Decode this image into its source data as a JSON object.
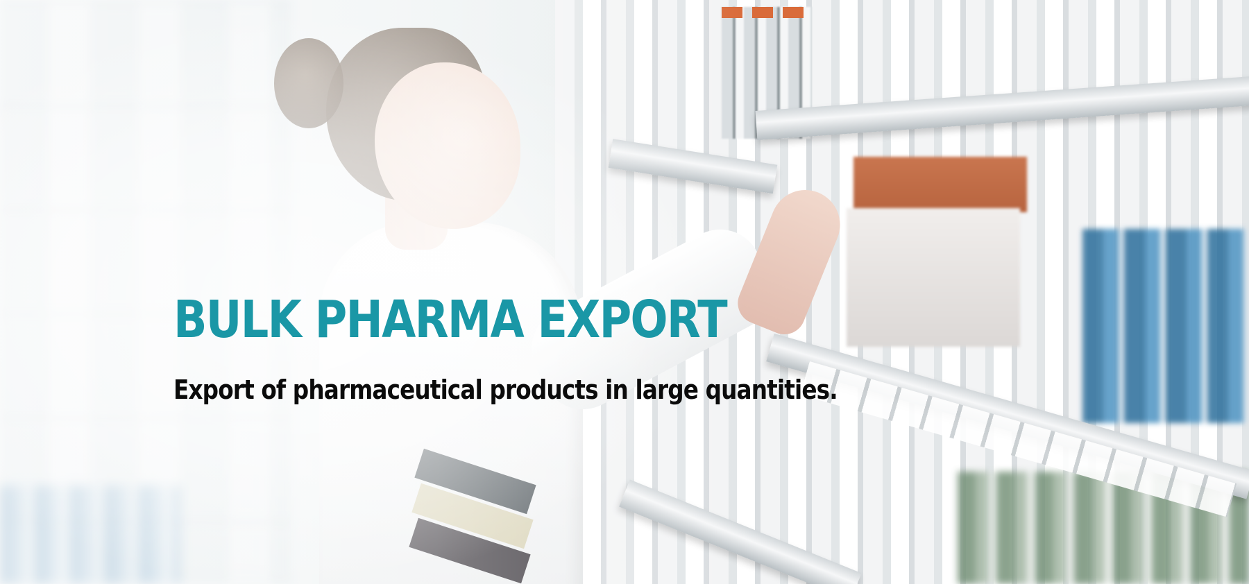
{
  "hero": {
    "headline": "BULK PHARMA EXPORT",
    "subline": "Export of pharmaceutical products in large quantities."
  },
  "colors": {
    "headline": "#1a97a6",
    "subline": "#0b0b0b"
  }
}
